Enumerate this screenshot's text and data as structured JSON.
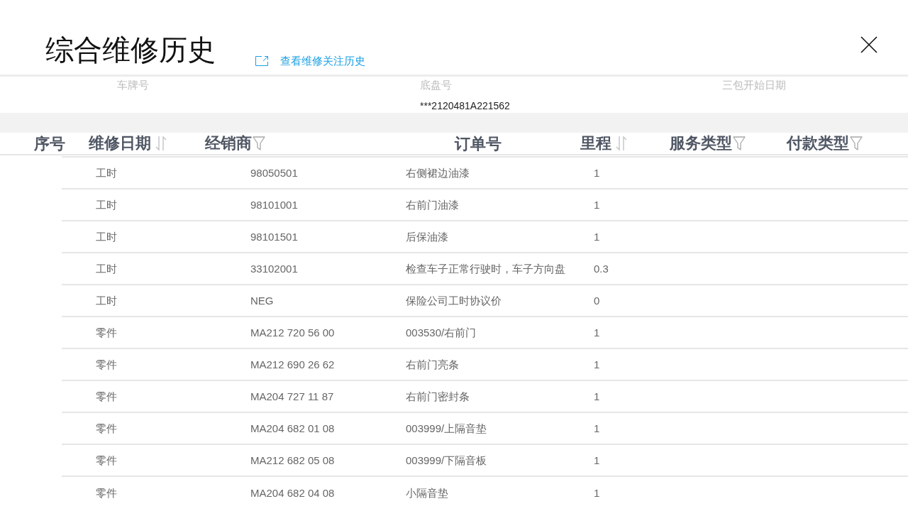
{
  "title": "综合维修历史",
  "link": {
    "label": "查看维修关注历史"
  },
  "vehicle_info": [
    {
      "label": "车牌号"
    },
    {
      "label": "底盘号",
      "value": "***2120481A221562"
    },
    {
      "label": "三包开始日期"
    }
  ],
  "table": {
    "columns": [
      {
        "label": "序号",
        "kind": "plain"
      },
      {
        "label": "维修日期",
        "kind": "sortable"
      },
      {
        "label": "经销商",
        "kind": "filterable"
      },
      {
        "label": "订单号",
        "kind": "plain"
      },
      {
        "label": "里程",
        "kind": "sortable"
      },
      {
        "label": "服务类型",
        "kind": "filterable"
      },
      {
        "label": "付款类型",
        "kind": "filterable"
      }
    ]
  },
  "detail_rows": [
    [
      "工时",
      "98050501",
      "右侧裙边油漆",
      "1"
    ],
    [
      "工时",
      "98101001",
      "右前门油漆",
      "1"
    ],
    [
      "工时",
      "98101501",
      "后保油漆",
      "1"
    ],
    [
      "工时",
      "33102001",
      "检查车子正常行驶时，车子方向盘",
      "0.3"
    ],
    [
      "工时",
      "NEG",
      "保险公司工时协议价",
      "0"
    ],
    [
      "零件",
      "MA212 720 56 00",
      "003530/右前门",
      "1"
    ],
    [
      "零件",
      "MA212 690 26 62",
      "右前门亮条",
      "1"
    ],
    [
      "零件",
      "MA204 727 11 87",
      "右前门密封条",
      "1"
    ],
    [
      "零件",
      "MA204 682 01 08",
      "003999/上隔音垫",
      "1"
    ],
    [
      "零件",
      "MA212 682 05 08",
      "003999/下隔音板",
      "1"
    ],
    [
      "零件",
      "MA204 682 04 08",
      "小隔音垫",
      "1"
    ]
  ]
}
